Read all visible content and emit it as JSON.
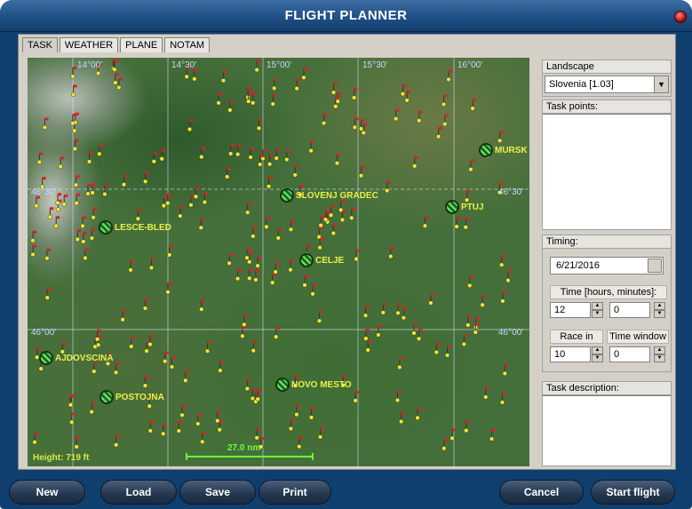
{
  "window": {
    "title": "FLIGHT PLANNER"
  },
  "tabs": [
    {
      "label": "TASK",
      "active": true
    },
    {
      "label": "WEATHER",
      "active": false
    },
    {
      "label": "PLANE",
      "active": false
    },
    {
      "label": "NOTAM",
      "active": false
    }
  ],
  "map": {
    "longitude_labels": [
      "14°00'",
      "14°30'",
      "15°00'",
      "15°30'",
      "16°00'"
    ],
    "latitude_labels": {
      "left_4630": "46°30'",
      "right_4630": "46°30'",
      "left_4600": "46°00'",
      "right_4600": "46°00'"
    },
    "towns": [
      "MURSK",
      "SLOVENJ GRADEC",
      "PTUJ",
      "LESCE-BLED",
      "CELJE",
      "AJDOVSCINA",
      "POSTOJNA",
      "NOVO MESTO"
    ],
    "height_text": "Height: 719 ft",
    "scale_text": "27.0 nm",
    "colors": {
      "town_label": "#e8f04a",
      "grid": "#d8e4ff",
      "scale": "#6aff3a"
    }
  },
  "landscape": {
    "header": "Landscape",
    "selected": "Slovenia [1.03]"
  },
  "task_points": {
    "header": "Task points:"
  },
  "timing": {
    "header": "Timing:",
    "date": "6/21/2016",
    "time_label": "Time [hours, minutes]:",
    "hours": "12",
    "minutes": "0",
    "race_in_label": "Race in",
    "race_in_value": "10",
    "time_window_label": "Time window",
    "time_window_value": "0"
  },
  "task_description": {
    "header": "Task description:"
  },
  "buttons": {
    "new": "New",
    "load": "Load",
    "save": "Save",
    "print": "Print",
    "cancel": "Cancel",
    "start": "Start flight"
  }
}
